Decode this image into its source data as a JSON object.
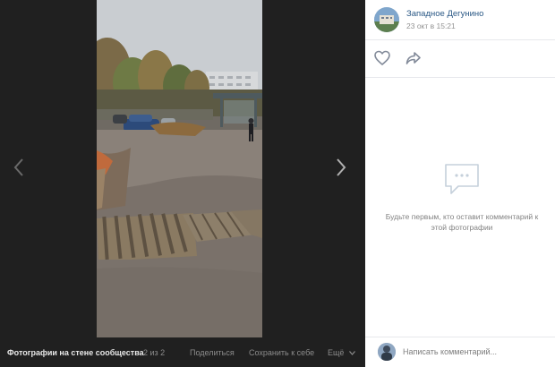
{
  "viewer": {
    "prev_icon": "chevron-left-icon",
    "next_icon": "chevron-right-icon",
    "bottom": {
      "album_label": "Фотографии на стене сообщества",
      "counter": "2 из 2",
      "share_label": "Поделиться",
      "save_label": "Сохранить к себе",
      "more_label": "Ещё"
    }
  },
  "post": {
    "group_name": "Западное Дегунино",
    "date": "23 окт в 15:21",
    "like_icon": "heart-icon",
    "share_icon": "share-arrow-icon"
  },
  "comments": {
    "empty_icon": "speech-bubble-icon",
    "empty_text": "Будьте первым, кто оставит комментарий к этой фотографии",
    "placeholder": "Написать комментарий..."
  },
  "colors": {
    "link": "#2a5885",
    "muted": "#939393",
    "viewer_bg": "#202020"
  }
}
